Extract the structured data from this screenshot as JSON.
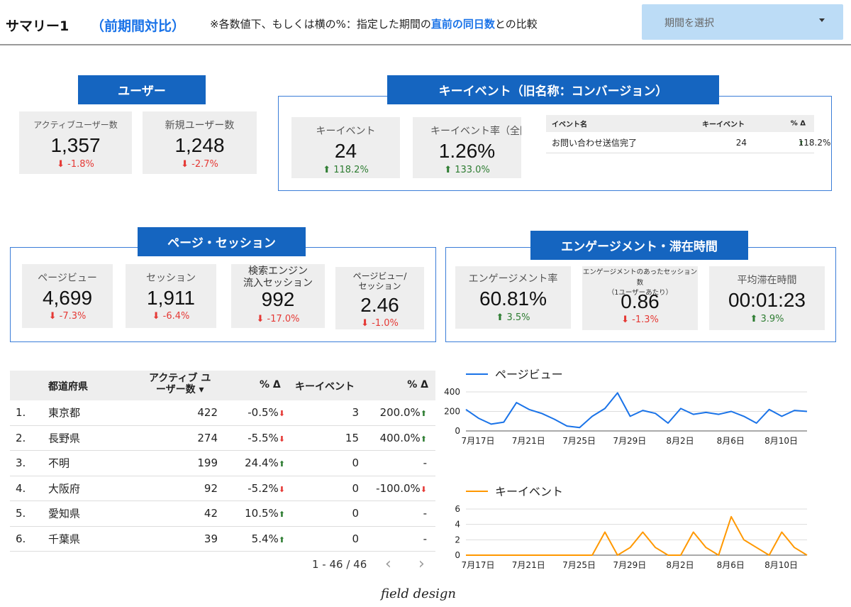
{
  "header": {
    "title": "サマリー1",
    "subtitle": "（前期間対比）",
    "note_prefix": "※各数値下、もしくは横の%：指定した期間の",
    "note_em": "直前の同日数",
    "note_suffix": "との比較",
    "period_label": "期間を選択"
  },
  "colors": {
    "accent": "#1565c0",
    "down": "#e53935",
    "up": "#2e7d32",
    "pageview_line": "#1a73e8",
    "keyevent_line": "#ff9800"
  },
  "users": {
    "section": "ユーザー",
    "cards": [
      {
        "label": "アクティブユーザー数",
        "value": "1,357",
        "change": "-1.8%",
        "dir": "down"
      },
      {
        "label": "新規ユーザー数",
        "value": "1,248",
        "change": "-2.7%",
        "dir": "down"
      }
    ]
  },
  "keyevents": {
    "section": "キーイベント（旧名称：コンバージョン）",
    "cards": [
      {
        "label": "キーイベント",
        "value": "24",
        "change": "118.2%",
        "dir": "up"
      },
      {
        "label": "キーイベント率（全回数）",
        "value": "1.26%",
        "change": "133.0%",
        "dir": "up"
      }
    ],
    "table": {
      "headers": [
        "イベント名",
        "キーイベント",
        "% Δ"
      ],
      "rows": [
        {
          "name": "お問い合わせ送信完了",
          "count": "24",
          "delta": "118.2%"
        }
      ]
    }
  },
  "pages": {
    "section": "ページ・セッション",
    "cards": [
      {
        "label": "ページビュー",
        "value": "4,699",
        "change": "-7.3%",
        "dir": "down"
      },
      {
        "label": "セッション",
        "value": "1,911",
        "change": "-6.4%",
        "dir": "down"
      },
      {
        "label": "検索エンジン\n流入セッション",
        "value": "992",
        "change": "-17.0%",
        "dir": "down"
      },
      {
        "label": "ページビュー/\nセッション",
        "value": "2.46",
        "change": "-1.0%",
        "dir": "down"
      }
    ]
  },
  "engagement": {
    "section": "エンゲージメント・滞在時間",
    "cards": [
      {
        "label": "エンゲージメント率",
        "value": "60.81%",
        "change": "3.5%",
        "dir": "up"
      },
      {
        "label": "エンゲージメントのあったセッション数\n（1ユーザーあたり）",
        "value": "0.86",
        "change": "-1.3%",
        "dir": "down"
      },
      {
        "label": "平均滞在時間",
        "value": "00:01:23",
        "change": "3.9%",
        "dir": "up"
      }
    ]
  },
  "geo_table": {
    "headers": {
      "pref": "都道府県",
      "users": "アクティブ ユ\nーザー数 ▾",
      "delta1": "% Δ",
      "events": "キーイベント",
      "delta2": "% Δ"
    },
    "rows": [
      {
        "rank": "1.",
        "pref": "東京都",
        "users": "422",
        "d1": "-0.5%",
        "d1dir": "down",
        "events": "3",
        "d2": "200.0%",
        "d2dir": "up"
      },
      {
        "rank": "2.",
        "pref": "長野県",
        "users": "274",
        "d1": "-5.5%",
        "d1dir": "down",
        "events": "15",
        "d2": "400.0%",
        "d2dir": "up"
      },
      {
        "rank": "3.",
        "pref": "不明",
        "users": "199",
        "d1": "24.4%",
        "d1dir": "up",
        "events": "0",
        "d2": "-",
        "d2dir": ""
      },
      {
        "rank": "4.",
        "pref": "大阪府",
        "users": "92",
        "d1": "-5.2%",
        "d1dir": "down",
        "events": "0",
        "d2": "-100.0%",
        "d2dir": "down"
      },
      {
        "rank": "5.",
        "pref": "愛知県",
        "users": "42",
        "d1": "10.5%",
        "d1dir": "up",
        "events": "0",
        "d2": "-",
        "d2dir": ""
      },
      {
        "rank": "6.",
        "pref": "千葉県",
        "users": "39",
        "d1": "5.4%",
        "d1dir": "up",
        "events": "0",
        "d2": "-",
        "d2dir": ""
      }
    ],
    "pager": "1 - 46 / 46"
  },
  "chart_data": [
    {
      "type": "line",
      "x": [
        "7月17日",
        "7月18日",
        "7月19日",
        "7月20日",
        "7月21日",
        "7月22日",
        "7月23日",
        "7月24日",
        "7月25日",
        "7月26日",
        "7月27日",
        "7月28日",
        "7月29日",
        "7月30日",
        "7月31日",
        "8月1日",
        "8月2日",
        "8月3日",
        "8月4日",
        "8月5日",
        "8月6日",
        "8月7日",
        "8月8日",
        "8月9日",
        "8月10日",
        "8月11日",
        "8月12日",
        "8月13日"
      ],
      "x_ticks": [
        "7月17日",
        "7月21日",
        "7月25日",
        "7月29日",
        "8月2日",
        "8月6日",
        "8月10日"
      ],
      "series": [
        {
          "name": "ページビュー",
          "values": [
            220,
            130,
            70,
            90,
            290,
            220,
            180,
            120,
            50,
            35,
            150,
            230,
            390,
            150,
            210,
            180,
            80,
            230,
            170,
            190,
            170,
            200,
            150,
            80,
            220,
            150,
            210,
            200
          ]
        }
      ],
      "ylim": [
        0,
        400
      ],
      "yticks": [
        0,
        200,
        400
      ]
    },
    {
      "type": "line",
      "x": [
        "7月17日",
        "7月18日",
        "7月19日",
        "7月20日",
        "7月21日",
        "7月22日",
        "7月23日",
        "7月24日",
        "7月25日",
        "7月26日",
        "7月27日",
        "7月28日",
        "7月29日",
        "7月30日",
        "7月31日",
        "8月1日",
        "8月2日",
        "8月3日",
        "8月4日",
        "8月5日",
        "8月6日",
        "8月7日",
        "8月8日",
        "8月9日",
        "8月10日",
        "8月11日",
        "8月12日",
        "8月13日"
      ],
      "x_ticks": [
        "7月17日",
        "7月21日",
        "7月25日",
        "7月29日",
        "8月2日",
        "8月6日",
        "8月10日"
      ],
      "series": [
        {
          "name": "キーイベント",
          "values": [
            0,
            0,
            0,
            0,
            0,
            0,
            0,
            0,
            0,
            0,
            0,
            3,
            0,
            1,
            3,
            1,
            0,
            0,
            3,
            1,
            0,
            5,
            2,
            1,
            0,
            3,
            1,
            0
          ]
        }
      ],
      "ylim": [
        0,
        6
      ],
      "yticks": [
        0,
        2,
        4,
        6
      ]
    }
  ],
  "logo": "field design"
}
